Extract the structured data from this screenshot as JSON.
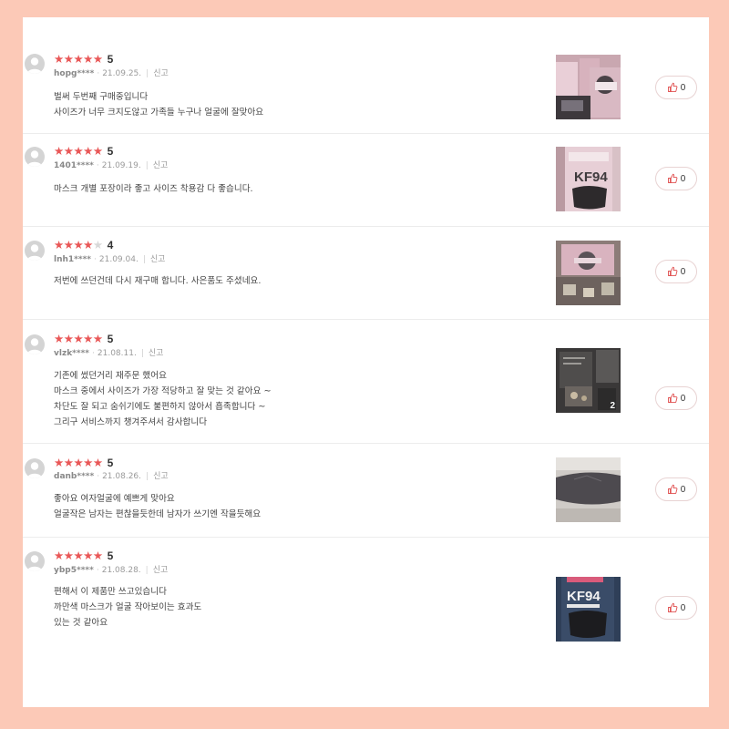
{
  "reviews": [
    {
      "rating_stars": 5,
      "rating": "5",
      "user": "hopg****",
      "date": "21.09.25.",
      "report": "신고",
      "lines": [
        "벌써 두번째 구매중입니다",
        "사이즈가 너무 크지도않고 가족들 누구나 얼굴에 잘맞아요"
      ],
      "photo_count": "",
      "likes": "0"
    },
    {
      "rating_stars": 5,
      "rating": "5",
      "user": "1401****",
      "date": "21.09.19.",
      "report": "신고",
      "lines": [
        "마스크 개별 포장이라 좋고 사이즈 착용감 다 좋습니다."
      ],
      "photo_count": "",
      "likes": "0"
    },
    {
      "rating_stars": 4,
      "rating": "4",
      "user": "lnh1****",
      "date": "21.09.04.",
      "report": "신고",
      "lines": [
        "저번에 쓰던건데 다시 재구매 합니다. 사은품도 주셨네요."
      ],
      "photo_count": "",
      "likes": "0"
    },
    {
      "rating_stars": 5,
      "rating": "5",
      "user": "vlzk****",
      "date": "21.08.11.",
      "report": "신고",
      "lines": [
        "기존에 썼던거리 재주문 했어요",
        "마스크 중에서 사이즈가 가장 적당하고 잘 맞는 것 같아요 ~",
        "차단도 잘 되고 숨쉬기에도 불편하지 않아서 흡족합니다 ~",
        "그리구 서비스까지 챙겨주셔서 감사합니다"
      ],
      "photo_count": "2",
      "likes": "0"
    },
    {
      "rating_stars": 5,
      "rating": "5",
      "user": "danb****",
      "date": "21.08.26.",
      "report": "신고",
      "lines": [
        "좋아요 여자얼굴에 예쁘게 맞아요",
        "얼굴작은 남자는 편찮을듯한데 남자가 쓰기엔 작을듯해요"
      ],
      "photo_count": "",
      "likes": "0"
    },
    {
      "rating_stars": 5,
      "rating": "5",
      "user": "ybp5****",
      "date": "21.08.28.",
      "report": "신고",
      "lines": [
        "편해서 이 제품만 쓰고있습니다",
        "까만색 마스크가 얼굴 작아보이는 효과도",
        "있는 것 같아요"
      ],
      "photo_count": "",
      "likes": "0"
    }
  ],
  "icons": {
    "avatar": "default-avatar-icon",
    "like": "thumbs-up-icon",
    "star": "star-icon"
  },
  "colors": {
    "background": "#fcc9b7",
    "star": "#e95757",
    "star_off": "#d8d8d8"
  }
}
